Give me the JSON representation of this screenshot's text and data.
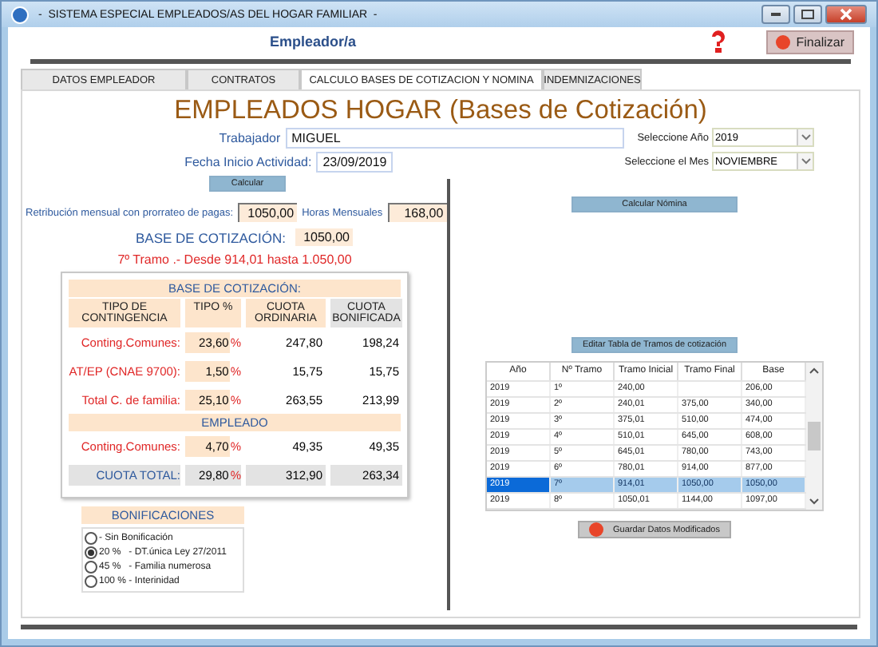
{
  "window": {
    "title": "-  SISTEMA ESPECIAL EMPLEADOS/AS DEL HOGAR FAMILIAR  -"
  },
  "header": {
    "label": "Empleador/a",
    "finish_button": "Finalizar"
  },
  "tabs": [
    {
      "label": "DATOS EMPLEADOR",
      "selected": false
    },
    {
      "label": "CONTRATOS",
      "selected": false
    },
    {
      "label": "CALCULO BASES DE COTIZACION  Y NOMINA",
      "selected": true
    },
    {
      "label": "INDEMNIZACIONES",
      "selected": false
    }
  ],
  "heading": "EMPLEADOS HOGAR (Bases de Cotización)",
  "form": {
    "worker_label": "Trabajador",
    "worker": "MIGUEL",
    "start_label": "Fecha Inicio Actividad:",
    "start": "23/09/2019",
    "year_label": "Seleccione Año",
    "year": "2019",
    "month_label": "Seleccione el Mes",
    "month": "NOVIEMBRE"
  },
  "left": {
    "calc_button": "Calcular",
    "pay_label": "Retribución mensual con prorrateo de pagas:",
    "pay": "1050,00",
    "hours_label": "Horas Mensuales",
    "hours": "168,00",
    "base_label": "BASE DE COTIZACIÓN:",
    "base": "1050,00",
    "tramo_note": "7º Tramo .- Desde 914,01 hasta 1.050,00"
  },
  "cotizacion": {
    "title": "BASE DE COTIZACIÓN:",
    "columns": [
      "TIPO DE CONTINGENCIA",
      "TIPO %",
      "CUOTA ORDINARIA",
      "CUOTA BONIFICADA"
    ],
    "rows": [
      {
        "kind": "row",
        "label": "Conting.Comunes:",
        "rate": "23,60",
        "unit": "%",
        "ordinaria": "247,80",
        "bonificada": "198,24"
      },
      {
        "kind": "row",
        "label": "AT/EP (CNAE 9700):",
        "rate": "1,50",
        "unit": "%",
        "ordinaria": "15,75",
        "bonificada": "15,75"
      },
      {
        "kind": "row",
        "label": "Total C. de familia:",
        "rate": "25,10",
        "unit": "%",
        "ordinaria": "263,55",
        "bonificada": "213,99"
      },
      {
        "kind": "section",
        "title": "EMPLEADO"
      },
      {
        "kind": "row",
        "label": "Conting.Comunes:",
        "rate": "4,70",
        "unit": "%",
        "ordinaria": "49,35",
        "bonificada": "49,35"
      },
      {
        "kind": "total",
        "label": "CUOTA TOTAL:",
        "rate": "29,80",
        "unit": "%",
        "ordinaria": "312,90",
        "bonificada": "263,34"
      }
    ]
  },
  "bonificaciones": {
    "title": "BONIFICACIONES",
    "options": [
      {
        "label": "- Sin Bonificación",
        "selected": false
      },
      {
        "label": "20 %   - DT.única Ley 27/2011",
        "selected": true
      },
      {
        "label": "45 %   - Familia numerosa",
        "selected": false
      },
      {
        "label": "100 % - Interinidad",
        "selected": false
      }
    ]
  },
  "right": {
    "payroll_button": "Calcular Nómina",
    "edit_button": "Editar Tabla de Tramos de cotización",
    "save_button": "Guardar Datos Modificados"
  },
  "tramos": {
    "columns": [
      "Año",
      "Nº Tramo",
      "Tramo Inicial",
      "Tramo Final",
      "Base"
    ],
    "rows": [
      {
        "cells": [
          "2019",
          "1º",
          "240,00",
          "",
          "206,00"
        ],
        "selected": false
      },
      {
        "cells": [
          "2019",
          "2º",
          "240,01",
          "375,00",
          "340,00"
        ],
        "selected": false
      },
      {
        "cells": [
          "2019",
          "3º",
          "375,01",
          "510,00",
          "474,00"
        ],
        "selected": false
      },
      {
        "cells": [
          "2019",
          "4º",
          "510,01",
          "645,00",
          "608,00"
        ],
        "selected": false
      },
      {
        "cells": [
          "2019",
          "5º",
          "645,01",
          "780,00",
          "743,00"
        ],
        "selected": false
      },
      {
        "cells": [
          "2019",
          "6º",
          "780,01",
          "914,00",
          "877,00"
        ],
        "selected": false
      },
      {
        "cells": [
          "2019",
          "7º",
          "914,01",
          "1050,00",
          "1050,00"
        ],
        "selected": true
      },
      {
        "cells": [
          "2019",
          "8º",
          "1050,01",
          "1144,00",
          "1097,00"
        ],
        "selected": false
      }
    ]
  }
}
